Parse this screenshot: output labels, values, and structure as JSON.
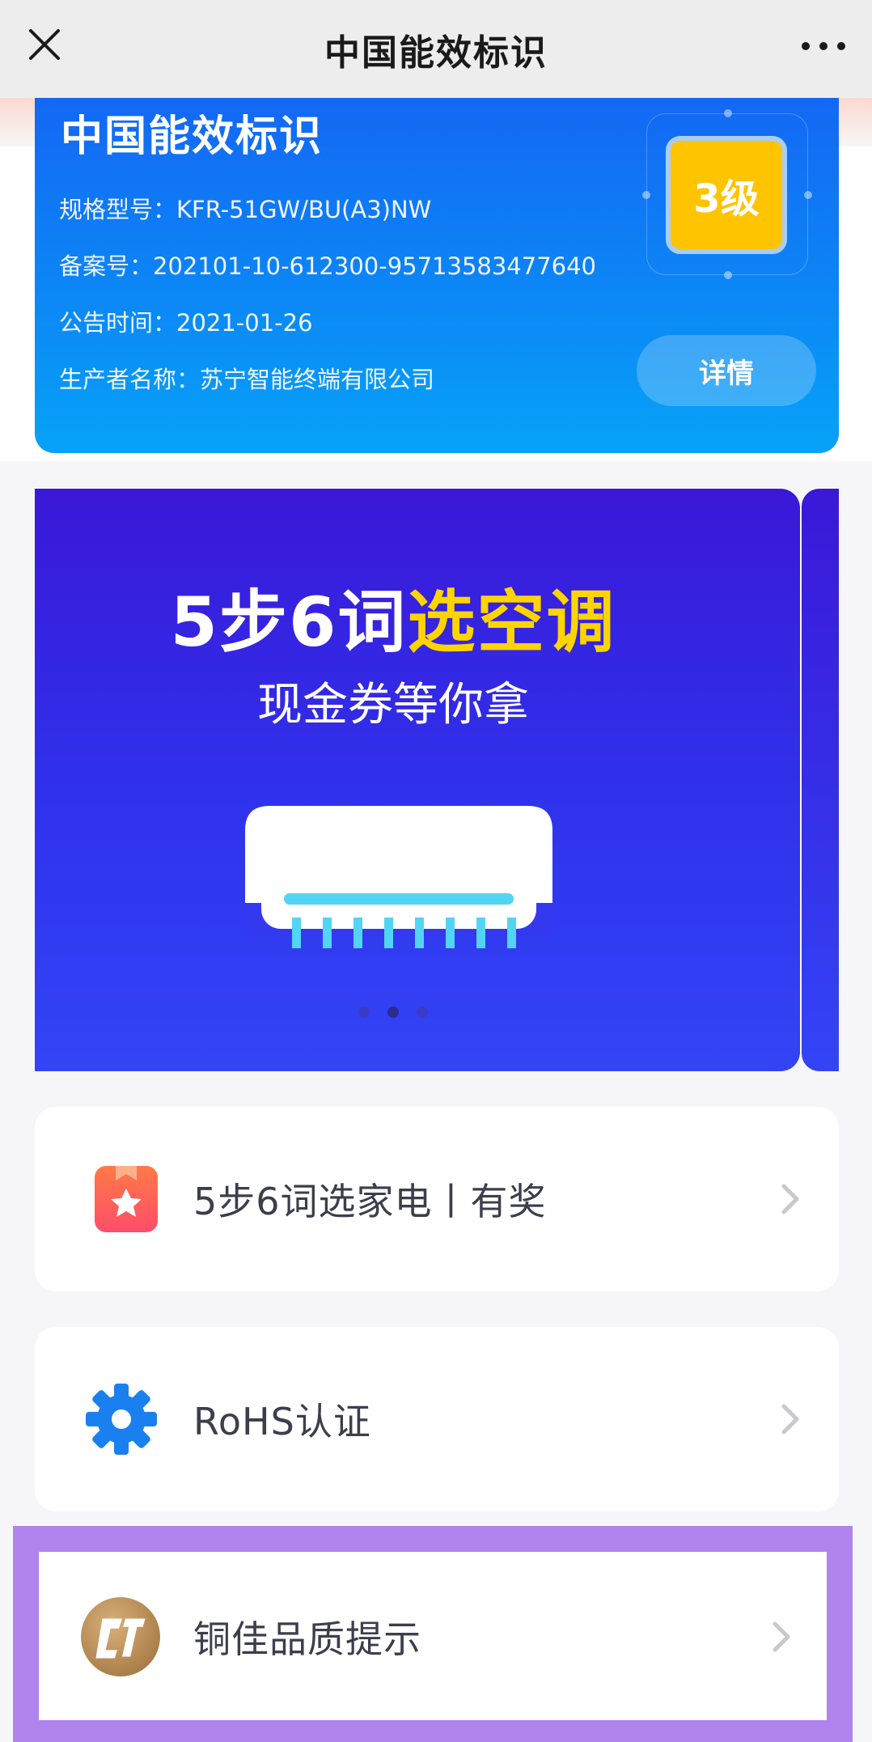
{
  "navbar": {
    "title": "中国能效标识",
    "close_icon": "close-icon",
    "more_icon": "more-dots-icon"
  },
  "energy_label": {
    "title": "中国能效标识",
    "model": "规格型号：KFR-51GW/BU(A3)NW",
    "record_no": "备案号：202101-10-612300-95713583477640",
    "announce_time": "公告时间：2021-01-26",
    "manufacturer": "生产者名称：苏宁智能终端有限公司",
    "grade": "3级",
    "detail_button": "详情",
    "grade_color": "#ffc400"
  },
  "banner": {
    "headline_white": "5步6词",
    "headline_yellow": "选空调",
    "subtitle": "现金券等你拿",
    "dots_count": 3,
    "active_dot": 2
  },
  "menu": [
    {
      "label": "5步6词选家电丨有奖",
      "icon": "ribbon-star-icon"
    },
    {
      "label": "RoHS认证",
      "icon": "gear-icon"
    },
    {
      "label": "铜佳品质提示",
      "icon": "ctl-logo-icon"
    }
  ],
  "colors": {
    "card_blue": "#1466f4",
    "banner_purple": "#3a18d8",
    "highlight": "#b083ee",
    "gear_blue": "#1a80f0"
  }
}
